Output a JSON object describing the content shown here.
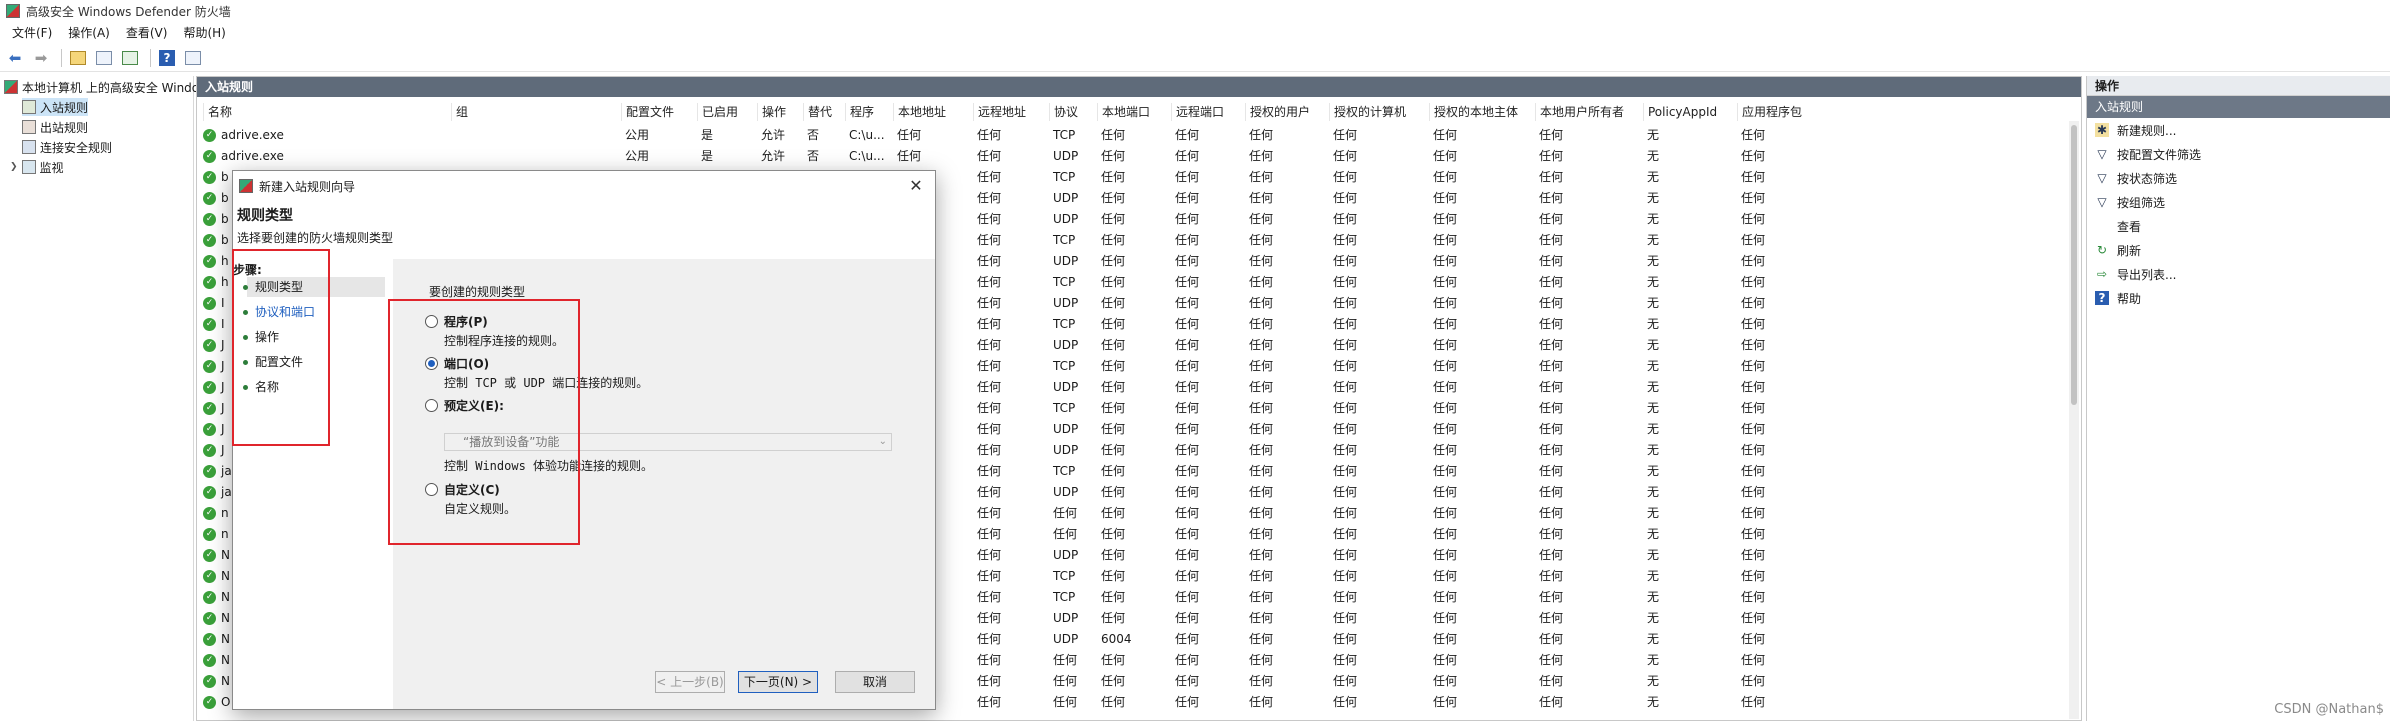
{
  "title_bar": {
    "title": "高级安全 Windows Defender 防火墙"
  },
  "menu": [
    "文件(F)",
    "操作(A)",
    "查看(V)",
    "帮助(H)"
  ],
  "toolbar": {
    "icons": [
      "back-arrow-icon",
      "forward-arrow-icon",
      "up-folder-icon",
      "show-pane-icon",
      "export-icon",
      "help-icon",
      "properties-icon"
    ]
  },
  "tree": {
    "root": "本地计算机 上的高级安全 Windo",
    "items": [
      "入站规则",
      "出站规则",
      "连接安全规则",
      "监视"
    ]
  },
  "center": {
    "header": "入站规则",
    "columns": [
      "名称",
      "组",
      "配置文件",
      "已启用",
      "操作",
      "替代",
      "程序",
      "本地地址",
      "远程地址",
      "协议",
      "本地端口",
      "远程端口",
      "授权的用户",
      "授权的计算机",
      "授权的本地主体",
      "本地用户所有者",
      "PolicyAppId",
      "应用程序包"
    ],
    "rows": [
      {
        "name": "adrive.exe",
        "profile": "公用",
        "enabled": "是",
        "action": "允许",
        "override": "否",
        "program": "C:\\u...",
        "laddr": "任何",
        "raddr": "任何",
        "proto": "TCP",
        "lport": "任何",
        "rport": "任何",
        "auser": "任何",
        "acomp": "任何",
        "alocal": "任何",
        "luser": "任何",
        "pid": "无",
        "pkg": "任何"
      },
      {
        "name": "adrive.exe",
        "profile": "公用",
        "enabled": "是",
        "action": "允许",
        "override": "否",
        "program": "C:\\u...",
        "laddr": "任何",
        "raddr": "任何",
        "proto": "UDP",
        "lport": "任何",
        "rport": "任何",
        "auser": "任何",
        "acomp": "任何",
        "alocal": "任何",
        "luser": "任何",
        "pid": "无",
        "pkg": "任何"
      },
      {
        "name": "b",
        "raddr": "任何",
        "proto": "TCP",
        "lport": "任何",
        "rport": "任何",
        "auser": "任何",
        "acomp": "任何",
        "alocal": "任何",
        "luser": "任何",
        "pid": "无",
        "pkg": "任何"
      },
      {
        "name": "b",
        "raddr": "任何",
        "proto": "UDP",
        "lport": "任何",
        "rport": "任何",
        "auser": "任何",
        "acomp": "任何",
        "alocal": "任何",
        "luser": "任何",
        "pid": "无",
        "pkg": "任何"
      },
      {
        "name": "b",
        "raddr": "任何",
        "proto": "UDP",
        "lport": "任何",
        "rport": "任何",
        "auser": "任何",
        "acomp": "任何",
        "alocal": "任何",
        "luser": "任何",
        "pid": "无",
        "pkg": "任何"
      },
      {
        "name": "b",
        "raddr": "任何",
        "proto": "TCP",
        "lport": "任何",
        "rport": "任何",
        "auser": "任何",
        "acomp": "任何",
        "alocal": "任何",
        "luser": "任何",
        "pid": "无",
        "pkg": "任何"
      },
      {
        "name": "h",
        "raddr": "任何",
        "proto": "UDP",
        "lport": "任何",
        "rport": "任何",
        "auser": "任何",
        "acomp": "任何",
        "alocal": "任何",
        "luser": "任何",
        "pid": "无",
        "pkg": "任何"
      },
      {
        "name": "h",
        "raddr": "任何",
        "proto": "TCP",
        "lport": "任何",
        "rport": "任何",
        "auser": "任何",
        "acomp": "任何",
        "alocal": "任何",
        "luser": "任何",
        "pid": "无",
        "pkg": "任何"
      },
      {
        "name": "I",
        "raddr": "任何",
        "proto": "UDP",
        "lport": "任何",
        "rport": "任何",
        "auser": "任何",
        "acomp": "任何",
        "alocal": "任何",
        "luser": "任何",
        "pid": "无",
        "pkg": "任何"
      },
      {
        "name": "I",
        "raddr": "任何",
        "proto": "TCP",
        "lport": "任何",
        "rport": "任何",
        "auser": "任何",
        "acomp": "任何",
        "alocal": "任何",
        "luser": "任何",
        "pid": "无",
        "pkg": "任何"
      },
      {
        "name": "J",
        "raddr": "任何",
        "proto": "UDP",
        "lport": "任何",
        "rport": "任何",
        "auser": "任何",
        "acomp": "任何",
        "alocal": "任何",
        "luser": "任何",
        "pid": "无",
        "pkg": "任何"
      },
      {
        "name": "J",
        "raddr": "任何",
        "proto": "TCP",
        "lport": "任何",
        "rport": "任何",
        "auser": "任何",
        "acomp": "任何",
        "alocal": "任何",
        "luser": "任何",
        "pid": "无",
        "pkg": "任何"
      },
      {
        "name": "J",
        "raddr": "任何",
        "proto": "UDP",
        "lport": "任何",
        "rport": "任何",
        "auser": "任何",
        "acomp": "任何",
        "alocal": "任何",
        "luser": "任何",
        "pid": "无",
        "pkg": "任何"
      },
      {
        "name": "J",
        "raddr": "任何",
        "proto": "TCP",
        "lport": "任何",
        "rport": "任何",
        "auser": "任何",
        "acomp": "任何",
        "alocal": "任何",
        "luser": "任何",
        "pid": "无",
        "pkg": "任何"
      },
      {
        "name": "J",
        "raddr": "任何",
        "proto": "UDP",
        "lport": "任何",
        "rport": "任何",
        "auser": "任何",
        "acomp": "任何",
        "alocal": "任何",
        "luser": "任何",
        "pid": "无",
        "pkg": "任何"
      },
      {
        "name": "J",
        "raddr": "任何",
        "proto": "UDP",
        "lport": "任何",
        "rport": "任何",
        "auser": "任何",
        "acomp": "任何",
        "alocal": "任何",
        "luser": "任何",
        "pid": "无",
        "pkg": "任何"
      },
      {
        "name": "ja",
        "raddr": "任何",
        "proto": "TCP",
        "lport": "任何",
        "rport": "任何",
        "auser": "任何",
        "acomp": "任何",
        "alocal": "任何",
        "luser": "任何",
        "pid": "无",
        "pkg": "任何"
      },
      {
        "name": "ja",
        "raddr": "任何",
        "proto": "UDP",
        "lport": "任何",
        "rport": "任何",
        "auser": "任何",
        "acomp": "任何",
        "alocal": "任何",
        "luser": "任何",
        "pid": "无",
        "pkg": "任何"
      },
      {
        "name": "n",
        "raddr": "任何",
        "proto": "任何",
        "lport": "任何",
        "rport": "任何",
        "auser": "任何",
        "acomp": "任何",
        "alocal": "任何",
        "luser": "任何",
        "pid": "无",
        "pkg": "任何"
      },
      {
        "name": "n",
        "raddr": "任何",
        "proto": "任何",
        "lport": "任何",
        "rport": "任何",
        "auser": "任何",
        "acomp": "任何",
        "alocal": "任何",
        "luser": "任何",
        "pid": "无",
        "pkg": "任何"
      },
      {
        "name": "N",
        "raddr": "任何",
        "proto": "UDP",
        "lport": "任何",
        "rport": "任何",
        "auser": "任何",
        "acomp": "任何",
        "alocal": "任何",
        "luser": "任何",
        "pid": "无",
        "pkg": "任何"
      },
      {
        "name": "N",
        "raddr": "任何",
        "proto": "TCP",
        "lport": "任何",
        "rport": "任何",
        "auser": "任何",
        "acomp": "任何",
        "alocal": "任何",
        "luser": "任何",
        "pid": "无",
        "pkg": "任何"
      },
      {
        "name": "N",
        "raddr": "任何",
        "proto": "TCP",
        "lport": "任何",
        "rport": "任何",
        "auser": "任何",
        "acomp": "任何",
        "alocal": "任何",
        "luser": "任何",
        "pid": "无",
        "pkg": "任何"
      },
      {
        "name": "N",
        "raddr": "任何",
        "proto": "UDP",
        "lport": "任何",
        "rport": "任何",
        "auser": "任何",
        "acomp": "任何",
        "alocal": "任何",
        "luser": "任何",
        "pid": "无",
        "pkg": "任何"
      },
      {
        "name": "N",
        "raddr": "任何",
        "proto": "UDP",
        "lport": "6004",
        "rport": "任何",
        "auser": "任何",
        "acomp": "任何",
        "alocal": "任何",
        "luser": "任何",
        "pid": "无",
        "pkg": "任何"
      },
      {
        "name": "N",
        "raddr": "任何",
        "proto": "任何",
        "lport": "任何",
        "rport": "任何",
        "auser": "任何",
        "acomp": "任何",
        "alocal": "任何",
        "luser": "任何",
        "pid": "无",
        "pkg": "任何"
      },
      {
        "name": "N",
        "raddr": "任何",
        "proto": "任何",
        "lport": "任何",
        "rport": "任何",
        "auser": "任何",
        "acomp": "任何",
        "alocal": "任何",
        "luser": "任何",
        "pid": "无",
        "pkg": "任何"
      },
      {
        "name": "O",
        "raddr": "任何",
        "proto": "任何",
        "lport": "任何",
        "rport": "任何",
        "auser": "任何",
        "acomp": "任何",
        "alocal": "任何",
        "luser": "任何",
        "pid": "无",
        "pkg": "任何"
      }
    ]
  },
  "actions": {
    "header": "操作",
    "sub": "入站规则",
    "items": [
      {
        "icon": "new-rule-icon",
        "label": "新建规则..."
      },
      {
        "icon": "filter-icon",
        "label": "按配置文件筛选"
      },
      {
        "icon": "filter-icon",
        "label": "按状态筛选"
      },
      {
        "icon": "filter-icon",
        "label": "按组筛选"
      },
      {
        "icon": "view-icon",
        "label": "查看"
      },
      {
        "icon": "refresh-icon",
        "label": "刷新"
      },
      {
        "icon": "export-icon",
        "label": "导出列表..."
      },
      {
        "icon": "help-icon",
        "label": "帮助"
      }
    ]
  },
  "wizard": {
    "title": "新建入站规则向导",
    "heading": "规则类型",
    "subheading": "选择要创建的防火墙规则类型",
    "steps_title": "步骤:",
    "steps": [
      "规则类型",
      "协议和端口",
      "操作",
      "配置文件",
      "名称"
    ],
    "question": "要创建的规则类型",
    "options": [
      {
        "label": "程序(P)",
        "desc": "控制程序连接的规则。"
      },
      {
        "label": "端口(O)",
        "desc": "控制 TCP 或 UDP 端口连接的规则。"
      },
      {
        "label": "预定义(E):",
        "desc": "控制 Windows 体验功能连接的规则。"
      },
      {
        "label": "自定义(C)",
        "desc": "自定义规则。"
      }
    ],
    "predefined_value": "“播放到设备”功能",
    "buttons": {
      "back": "< 上一步(B)",
      "next": "下一页(N) >",
      "cancel": "取消"
    }
  },
  "watermark": "CSDN @Nathan$"
}
